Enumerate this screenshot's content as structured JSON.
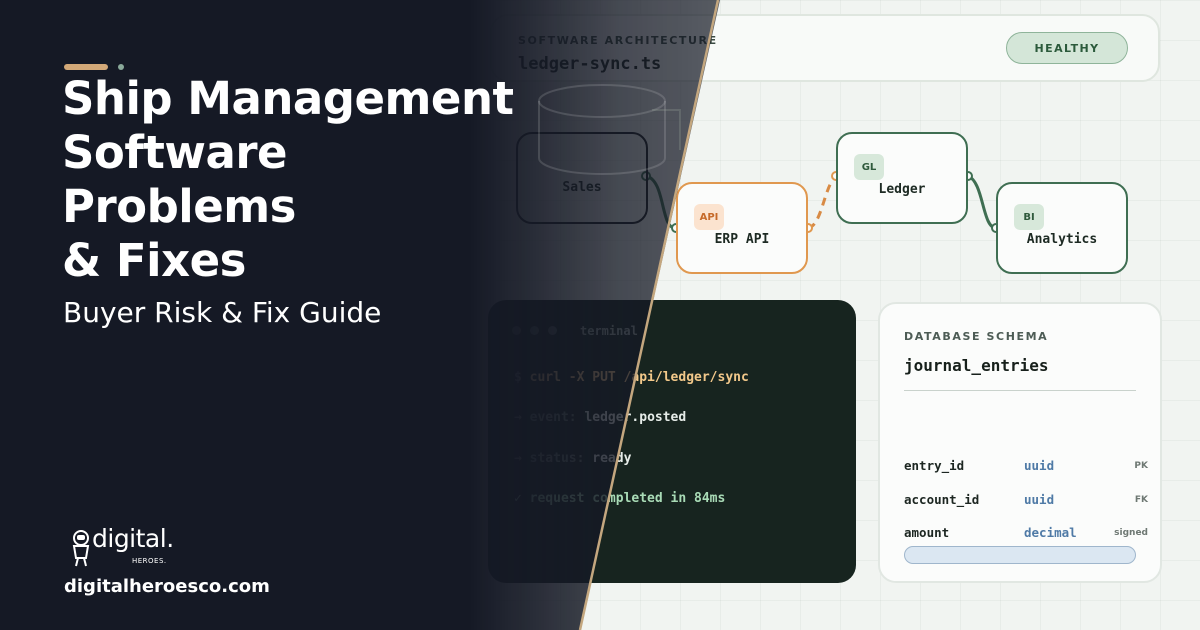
{
  "header": {
    "kicker": "SOFTWARE ARCHITECTURE",
    "filename": "ledger-sync.ts",
    "status_badge": "HEALTHY"
  },
  "diagram": {
    "nodes": [
      {
        "label": "Sales"
      },
      {
        "label": "ERP API",
        "tag": "API"
      },
      {
        "label": "Ledger",
        "tag": "GL"
      },
      {
        "label": "Analytics",
        "tag": "BI"
      }
    ]
  },
  "terminal": {
    "title": "terminal",
    "lines": [
      {
        "prefix": "$ ",
        "text": "curl -X PUT /api/ledger/sync"
      },
      {
        "prefix": "→ ",
        "label": "event: ",
        "value": "ledger.posted"
      },
      {
        "prefix": "→ ",
        "label": "status: ",
        "value": "ready"
      },
      {
        "prefix": "✓ ",
        "text": "request completed in 84ms"
      }
    ]
  },
  "schema": {
    "kicker": "DATABASE SCHEMA",
    "table_name": "journal_entries",
    "rows": [
      {
        "field": "entry_id",
        "type": "uuid",
        "key": "PK"
      },
      {
        "field": "account_id",
        "type": "uuid",
        "key": "FK"
      },
      {
        "field": "amount",
        "type": "decimal",
        "key": "signed"
      }
    ]
  },
  "hero": {
    "headline_lines": [
      "Ship Management",
      "Software",
      "Problems",
      "& Fixes"
    ],
    "subheadline": "Buyer Risk & Fix Guide"
  },
  "brand": {
    "logo_word": "digital.",
    "logo_sub": "HEROES.",
    "website": "digitalheroesco.com"
  },
  "colors": {
    "dark_panel": "#151925",
    "accent_gold": "#d2a878",
    "node_green": "#3f6e52",
    "node_orange": "#e0984f",
    "terminal_bg": "#17241f"
  }
}
